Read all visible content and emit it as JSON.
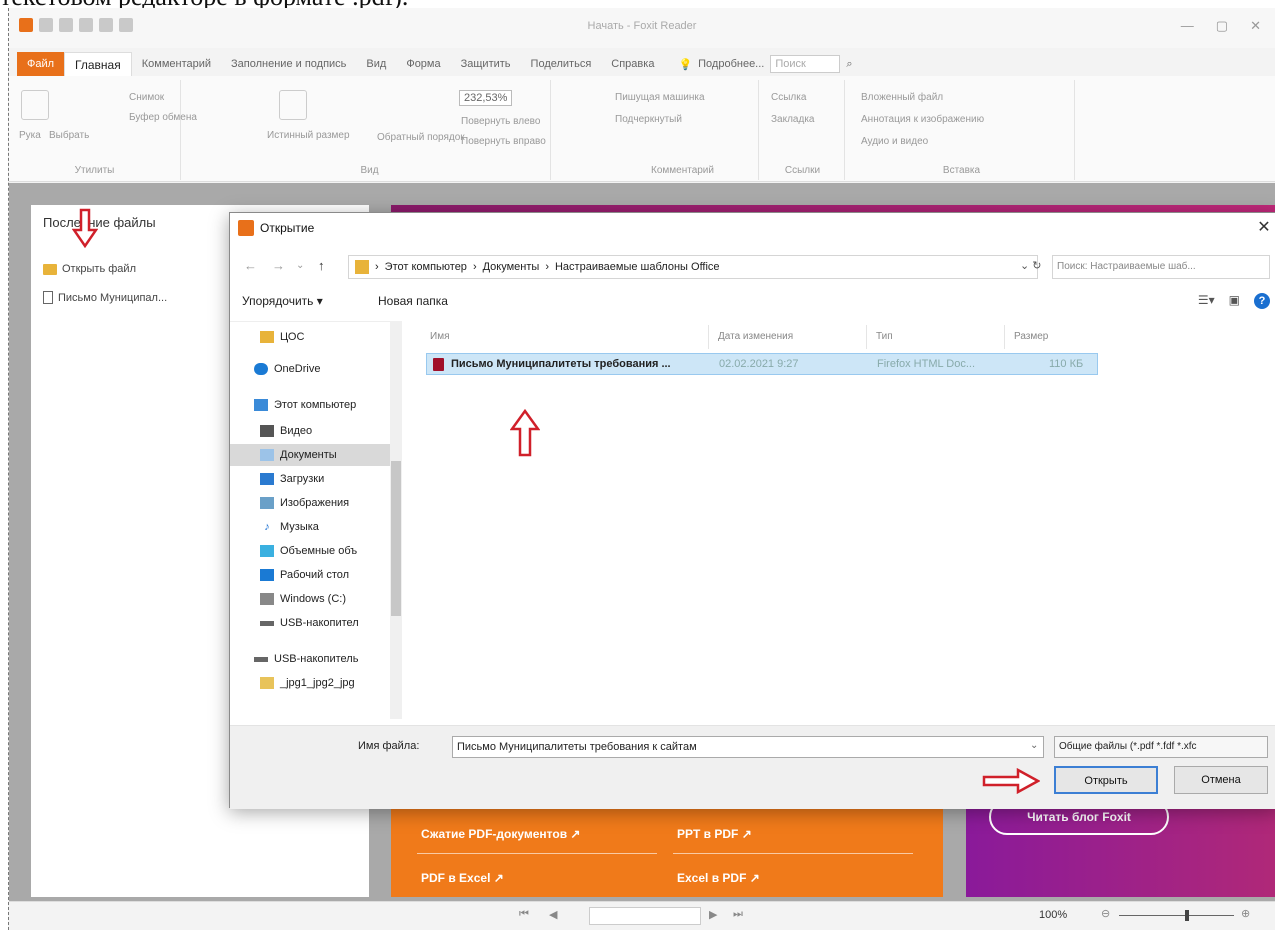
{
  "caption": "текстовом редакторе в формате .pdf).",
  "app": {
    "title": "Начать - Foxit Reader",
    "tabs": [
      "Файл",
      "Главная",
      "Комментарий",
      "Заполнение и подпись",
      "Вид",
      "Форма",
      "Защитить",
      "Поделиться",
      "Справка"
    ],
    "more_label": "Подробнее...",
    "search_placeholder": "Поиск"
  },
  "ribbon": {
    "groups": [
      {
        "label": "Утилиты",
        "buttons": [
          "Рука",
          "Выбрать",
          "Снимок",
          "Буфер обмена"
        ]
      },
      {
        "label": "Вид",
        "buttons": [
          "Истинный размер",
          "Обратный порядок",
          "Повернуть влево",
          "Повернуть вправо"
        ],
        "zoom": "232,53%"
      },
      {
        "label": "Комментарий",
        "buttons": [
          "Пишущая машинка",
          "Подчеркнутый"
        ]
      },
      {
        "label": "Ссылки",
        "buttons": [
          "Ссылка",
          "Закладка"
        ]
      },
      {
        "label": "Вставка",
        "buttons": [
          "Вложенный файл",
          "Аннотация к изображению",
          "Аудио и видео"
        ]
      }
    ]
  },
  "start_page": {
    "recent_title": "Последние файлы",
    "open_file": "Открыть файл",
    "recent_items": [
      "Письмо Муниципал..."
    ],
    "promo_links": [
      "Сжатие PDF-документов ↗",
      "PPT в PDF ↗",
      "PDF в Excel ↗",
      "Excel в PDF ↗"
    ],
    "blog_button": "Читать блог Foxit"
  },
  "status_bar": {
    "zoom": "100%"
  },
  "dialog": {
    "title": "Открытие",
    "path": [
      "Этот компьютер",
      "Документы",
      "Настраиваемые шаблоны Office"
    ],
    "search_placeholder": "Поиск: Настраиваемые шаб...",
    "organize": "Упорядочить ▾",
    "new_folder": "Новая папка",
    "nav_items": [
      {
        "label": "ЦОС",
        "icon": "folder-icon"
      },
      {
        "label": "OneDrive",
        "icon": "cloud-icon"
      },
      {
        "label": "Этот компьютер",
        "icon": "computer-icon"
      },
      {
        "label": "Видео",
        "icon": "video-icon"
      },
      {
        "label": "Документы",
        "icon": "documents-icon"
      },
      {
        "label": "Загрузки",
        "icon": "download-icon"
      },
      {
        "label": "Изображения",
        "icon": "images-icon"
      },
      {
        "label": "Музыка",
        "icon": "music-icon"
      },
      {
        "label": "Объемные объ",
        "icon": "3d-objects-icon"
      },
      {
        "label": "Рабочий стол",
        "icon": "desktop-icon"
      },
      {
        "label": "Windows (C:)",
        "icon": "drive-icon"
      },
      {
        "label": "USB-накопител",
        "icon": "usb-drive-icon"
      },
      {
        "label": "USB-накопитель",
        "icon": "usb-drive-icon"
      },
      {
        "label": "_jpg1_jpg2_jpg",
        "icon": "folder-icon"
      }
    ],
    "columns": [
      "Имя",
      "Дата изменения",
      "Тип",
      "Размер"
    ],
    "files": [
      {
        "name": "Письмо Муниципалитеты требования ...",
        "date": "02.02.2021 9:27",
        "type": "Firefox HTML Doc...",
        "size": "110 КБ"
      }
    ],
    "filename_label": "Имя файла:",
    "filename_value": "Письмо Муниципалитеты требования к сайтам",
    "filetype": "Общие файлы (*.pdf *.fdf *.xfc",
    "open_button": "Открыть",
    "cancel_button": "Отмена"
  },
  "colors": {
    "accent": "#e8701a",
    "selection": "#cde6f7",
    "annotation_arrow": "#d0202a"
  }
}
